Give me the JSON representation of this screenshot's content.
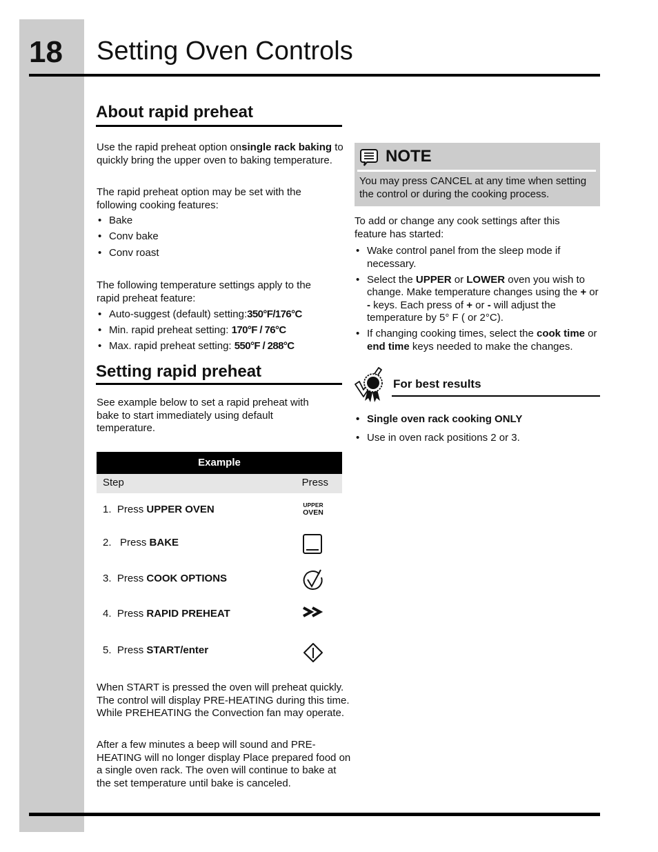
{
  "header": {
    "page_number": "18",
    "title": "Setting Oven Controls"
  },
  "about": {
    "heading": "About rapid preheat",
    "intro_before_bold": "Use the rapid preheat option on",
    "intro_bold": "single rack baking",
    "intro_after_bold": " to quickly bring the upper oven to baking temperature.",
    "features_intro": "The rapid preheat option may be set with the following cooking features:",
    "features": [
      "Bake",
      "Conv bake",
      "Conv roast"
    ],
    "temps_intro": "The following temperature settings apply to the rapid preheat feature:",
    "temps": [
      {
        "label": "Auto-suggest (default) setting:",
        "value": "350°F/176°C"
      },
      {
        "label": "Min. rapid preheat setting: ",
        "value": "170°F / 76°C"
      },
      {
        "label": "Max. rapid preheat setting: ",
        "value": "550°F / 288°C"
      }
    ]
  },
  "setting": {
    "heading": "Setting rapid preheat",
    "intro": "See example below to set a rapid preheat with bake to start immediately using default temperature.",
    "table": {
      "title": "Example",
      "col_step": "Step",
      "col_press": "Press",
      "steps": [
        {
          "num": "1.",
          "prefix": "Press ",
          "key": "UPPER OVEN",
          "icon": "upper-oven-key-icon",
          "icon_line1": "UPPER",
          "icon_line2": "OVEN"
        },
        {
          "num": "2.",
          "prefix": "Press ",
          "key": "BAKE",
          "icon": "bake-key-icon"
        },
        {
          "num": "3.",
          "prefix": "Press ",
          "key": "COOK OPTIONS",
          "icon": "cook-options-check-icon"
        },
        {
          "num": "4.",
          "prefix": "Press ",
          "key": "RAPID PREHEAT",
          "icon": "rapid-preheat-chevrons-icon"
        },
        {
          "num": "5.",
          "prefix": "Press ",
          "key": "START/enter",
          "icon": "start-diamond-icon"
        }
      ]
    },
    "after_start": "When START is pressed the oven will preheat quickly. The control will display PRE-HEATING during this time. While PREHEATING the Convection fan may operate.",
    "after_beep": "After a few minutes a beep will sound and PRE-HEATING will no longer display Place prepared food on a single oven rack. The oven will continue to bake at the set temperature until bake is canceled."
  },
  "note": {
    "icon": "note-speech-bubble-icon",
    "title": "NOTE",
    "text": "You may press CANCEL at any time when setting the control or during the cooking process."
  },
  "change": {
    "intro": "To add or change any cook settings after this feature has started:",
    "item1": "Wake control panel from the sleep mode if necessary.",
    "item2_a": "Select the ",
    "item2_b": "UPPER",
    "item2_c": " or ",
    "item2_d": "LOWER",
    "item2_e": " oven you wish to change. Make temperature changes using the ",
    "item2_f": "+",
    "item2_g": " or ",
    "item2_h": "-",
    "item2_i": " keys. Each press of ",
    "item2_j": "+",
    "item2_k": " or ",
    "item2_l": "-",
    "item2_m": " will adjust the temperature by 5° F ( or 2°C).",
    "item3_a": "If changing cooking times, select the ",
    "item3_b": "cook time",
    "item3_c": " or ",
    "item3_d": "end time",
    "item3_e": " keys needed to make the changes."
  },
  "best_results": {
    "icon": "award-ribbon-check-icon",
    "title": "For best results",
    "items": [
      {
        "text": "Single oven rack cooking ONLY",
        "bold": true
      },
      {
        "text": "Use in oven rack positions 2 or 3.",
        "bold": false
      }
    ]
  }
}
